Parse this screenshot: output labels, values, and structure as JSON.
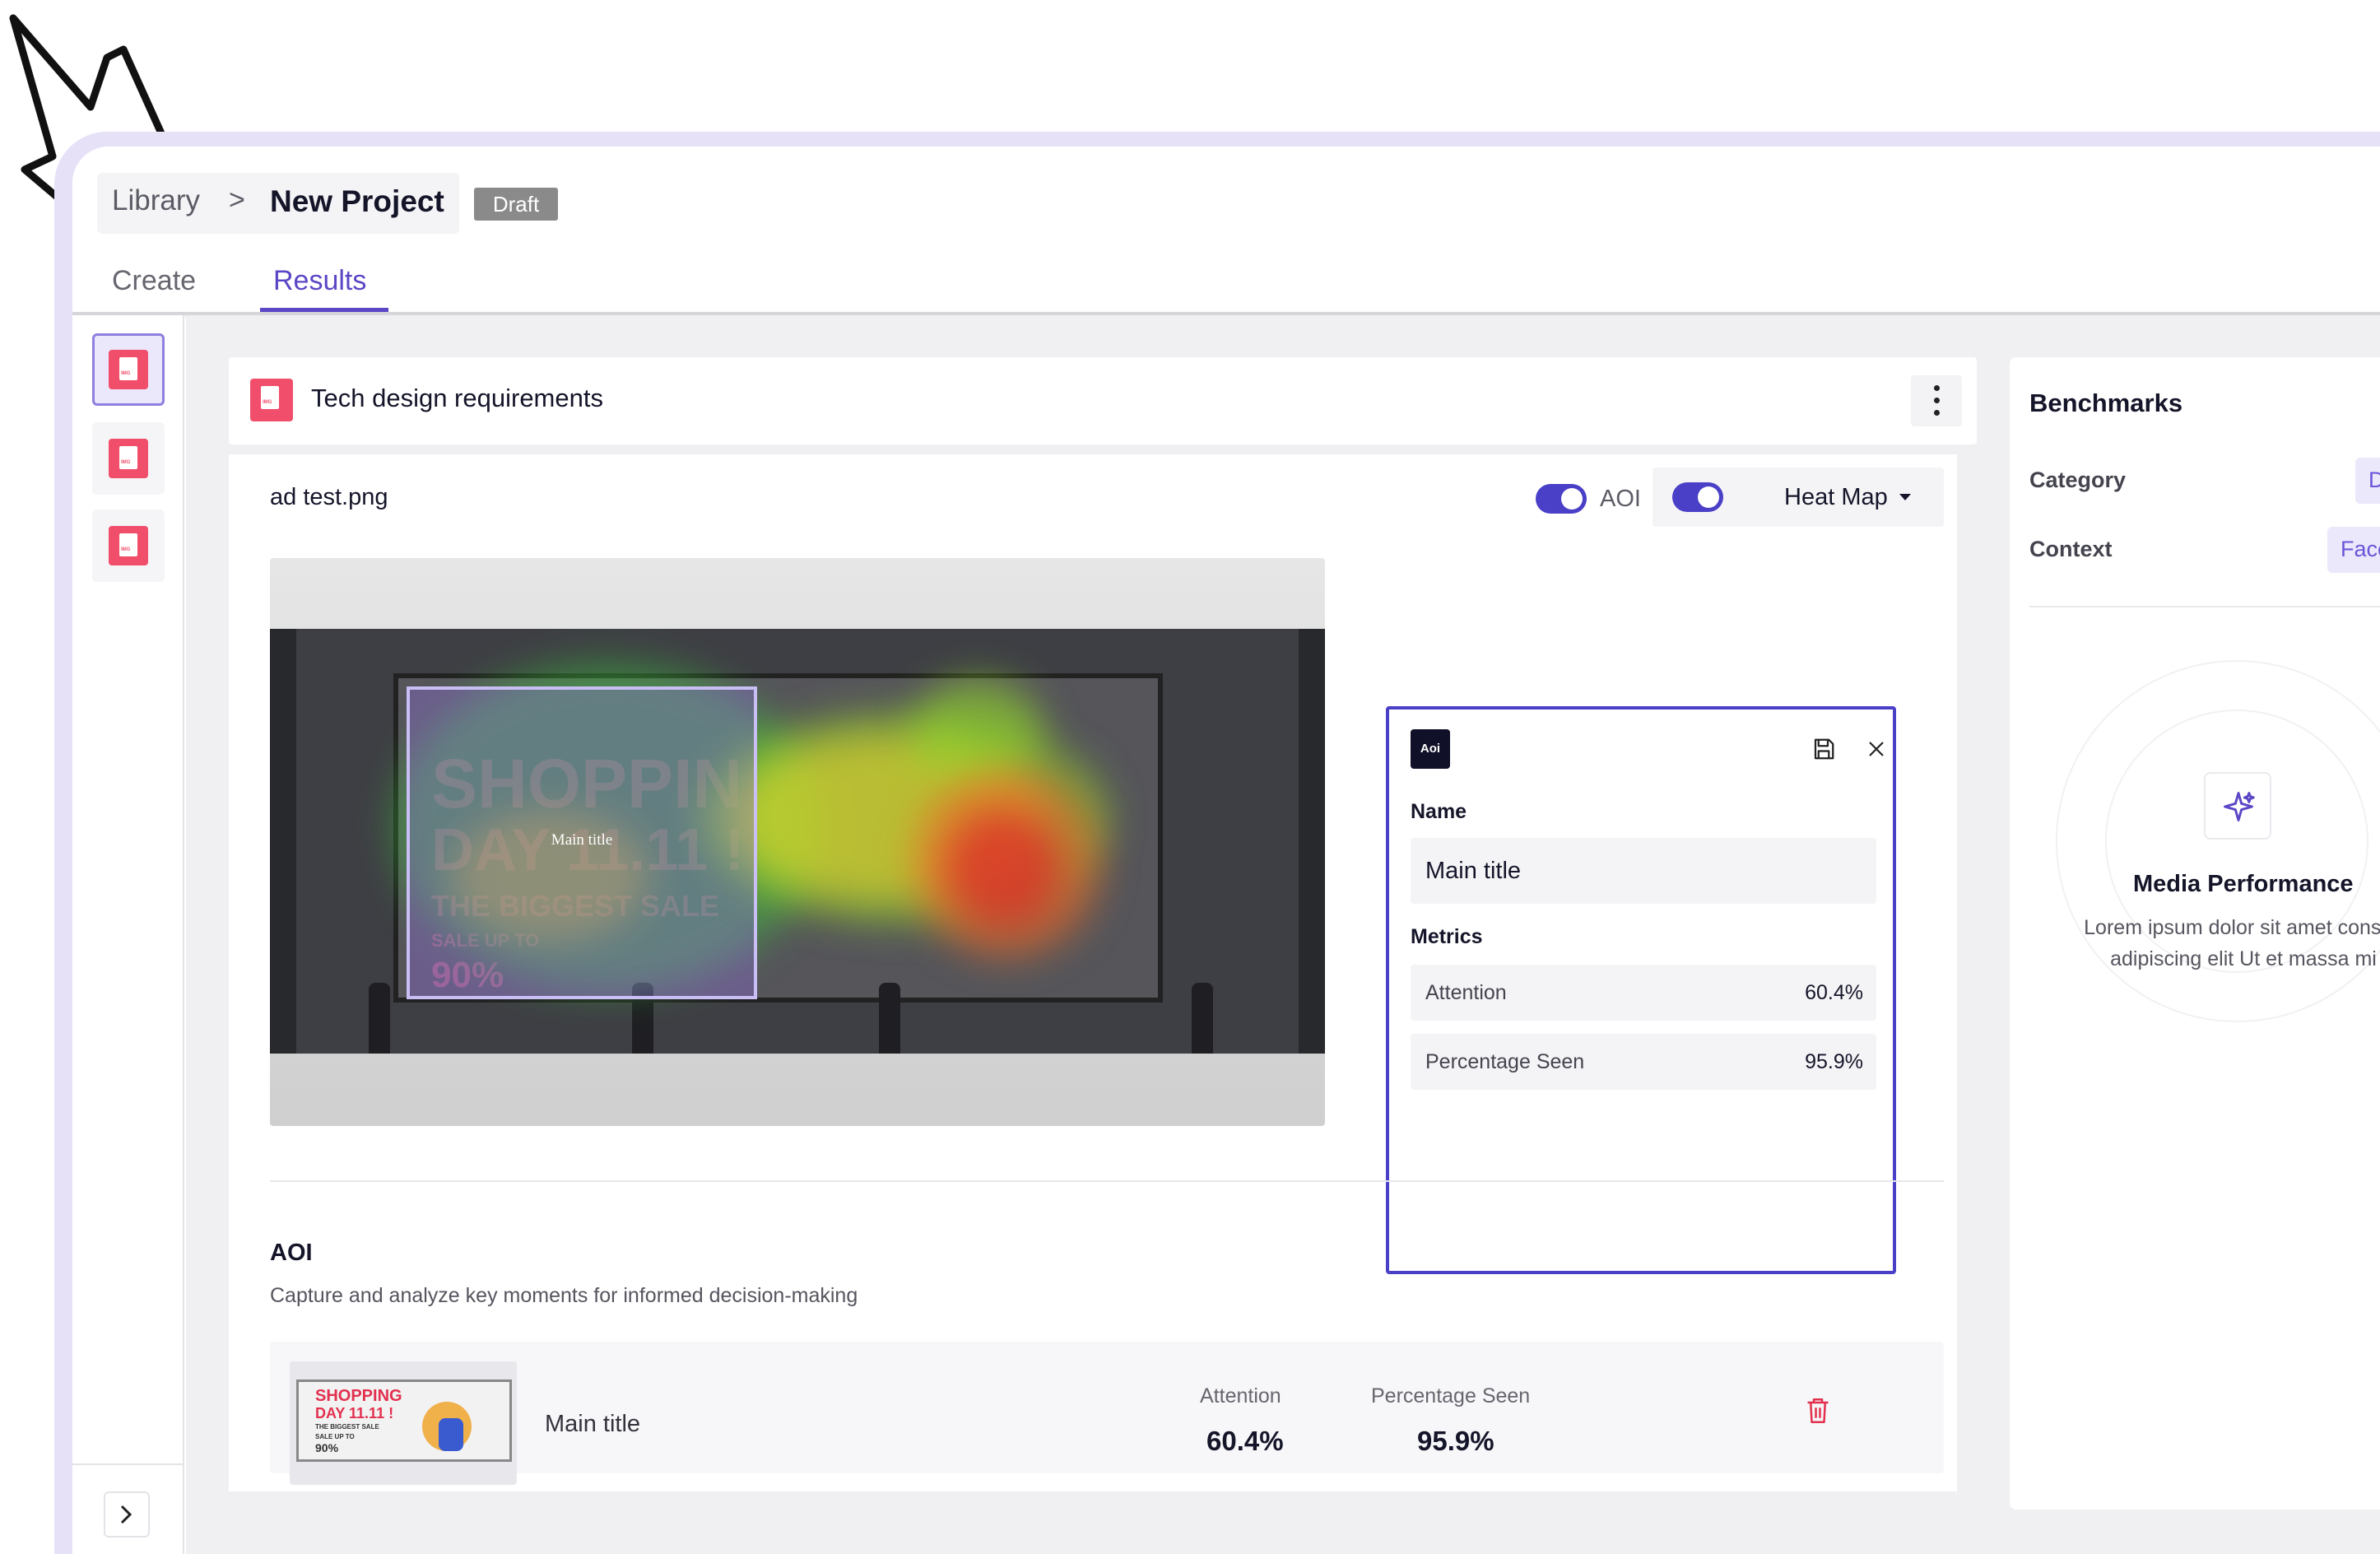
{
  "breadcrumb": {
    "library": "Library",
    "separator": ">",
    "project": "New Project",
    "status_badge": "Draft"
  },
  "tabs": [
    {
      "label": "Create",
      "active": false
    },
    {
      "label": "Results",
      "active": true
    }
  ],
  "document": {
    "title": "Tech design requirements"
  },
  "viewer": {
    "filename": "ad test.png",
    "aoi_toggle_label": "AOI",
    "aoi_toggle_on": true,
    "view_toggle_on": true,
    "view_mode": "Heat Map"
  },
  "image_overlay": {
    "aoi_box_label": "Main title",
    "billboard_text": [
      "SHOPPIN",
      "DAY 11.11 !",
      "THE BIGGEST SALE",
      "SALE UP TO",
      "90%"
    ]
  },
  "aoi_panel": {
    "chip": "Aoi",
    "name_label": "Name",
    "name_value": "Main title",
    "metrics_label": "Metrics",
    "metrics": [
      {
        "name": "Attention",
        "value": "60.4%"
      },
      {
        "name": "Percentage Seen",
        "value": "95.9%"
      }
    ]
  },
  "aoi_section": {
    "title": "AOI",
    "subtitle": "Capture and analyze key moments for informed decision-making",
    "rows": [
      {
        "name": "Main title",
        "thumbnail_text": [
          "SHOPPING",
          "DAY 11.11 !",
          "THE BIGGEST SALE",
          "SALE UP TO",
          "90%"
        ],
        "attention_label": "Attention",
        "attention_value": "60.4%",
        "seen_label": "Percentage Seen",
        "seen_value": "95.9%"
      }
    ]
  },
  "benchmarks": {
    "title": "Benchmarks",
    "category_label": "Category",
    "category_value": "D",
    "context_label": "Context",
    "context_value": "Face",
    "media_title": "Media Performance",
    "media_desc_line1": "Lorem ipsum dolor sit amet consec",
    "media_desc_line2": "adipiscing elit Ut et massa mi"
  },
  "colors": {
    "accent": "#5b46c6",
    "toggle": "#4a3fc7",
    "file_icon": "#f04e6b",
    "frame": "#e7e1f8",
    "danger": "#e2304e"
  },
  "icons": [
    "file-icon",
    "kebab-menu-icon",
    "chevron-right-icon",
    "caret-down-icon",
    "save-icon",
    "close-icon",
    "trash-icon",
    "sparkle-icon"
  ]
}
